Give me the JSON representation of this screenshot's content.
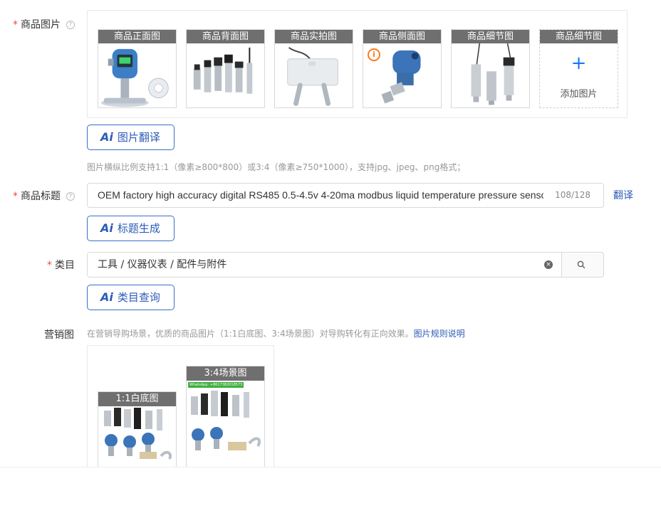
{
  "product_images": {
    "label": "商品图片",
    "required_mark": "*",
    "help_icon": "question-circle-icon",
    "thumbnails": [
      {
        "caption": "商品正面图"
      },
      {
        "caption": "商品背面图"
      },
      {
        "caption": "商品实拍图"
      },
      {
        "caption": "商品侧面图",
        "warning_icon": "info-circle-icon",
        "warning_color": "#ff7a1a"
      },
      {
        "caption": "商品细节图"
      }
    ],
    "add_slot": {
      "caption": "商品细节图",
      "plus": "+",
      "text": "添加图片"
    },
    "ai_button": {
      "ai": "Ai",
      "label": "图片翻译"
    },
    "hint": "图片横纵比例支持1:1（像素≥800*800）或3:4（像素≥750*1000），支持jpg、jpeg、png格式；"
  },
  "product_title": {
    "label": "商品标题",
    "required_mark": "*",
    "value": "OEM factory high accuracy digital RS485 0.5-4.5v 4-20ma modbus liquid temperature pressure sensor",
    "counter": "108/128",
    "translate_link": "翻译",
    "ai_button": {
      "ai": "Ai",
      "label": "标题生成"
    }
  },
  "category": {
    "label": "类目",
    "required_mark": "*",
    "value": "工具 / 仪器仪表 / 配件与附件",
    "clear_icon": "clear-circle-icon",
    "search_icon": "search-icon",
    "ai_button": {
      "ai": "Ai",
      "label": "类目查询"
    }
  },
  "marketing": {
    "label": "营销图",
    "hint": "在营销导购场景，优质的商品图片（1:1白底图、3:4场景图）对导购转化有正向效果。",
    "hint_link": "图片规则说明",
    "images": [
      {
        "caption": "1:1白底图"
      },
      {
        "caption": "3:4场景图",
        "badge": "WhatsApp: +8617382018573"
      }
    ]
  },
  "colors": {
    "accent": "#2d5bb7",
    "required": "#e54d42",
    "caption_bg": "#6f6f6f",
    "add_plus": "#1677ff"
  }
}
